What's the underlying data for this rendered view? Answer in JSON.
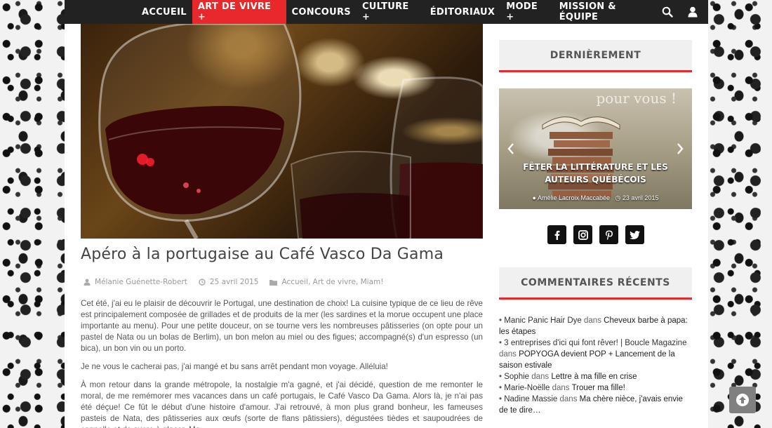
{
  "nav": {
    "items": [
      {
        "label": "ACCUEIL",
        "active": false
      },
      {
        "label": "ART DE VIVRE +",
        "active": true
      },
      {
        "label": "CONCOURS",
        "active": false
      },
      {
        "label": "CULTURE +",
        "active": false
      },
      {
        "label": "ÉDITORIAUX",
        "active": false
      },
      {
        "label": "MODE +",
        "active": false
      },
      {
        "label": "MISSION & ÉQUIPE",
        "active": false
      }
    ],
    "icons": [
      "search-icon",
      "user-icon"
    ],
    "accent_color": "#e8282b",
    "bar_color": "#222222"
  },
  "post": {
    "title": "Apéro à la portugaise au Café Vasco Da Gama",
    "author": "Mélanie Guénette-Robert",
    "date": "25 avril 2015",
    "categories": "Accueil, Art de vivre, Miam!",
    "paragraphs": [
      "Cet été, j'ai eu le plaisir de découvrir le Portugal, une destination de choix! La cuisine typique de ce lieu de rêve est principalement composée de grillades et de produits de la mer (les sardines et la morue occupent une place importante au menu). Pour une petite douceur, on se tourne vers les nombreuses pâtisseries (on opte pour un pastel de Nata ou un bolas de Berlim), un bon melon au miel ou des figues; accompagné(s) d'un espresso (un bica), un bon vin ou un porto.",
      "Je ne vous le cacherai pas, j'ai mangé et bu sans arrêt pendant mon voyage. Alléluia!",
      "À mon retour dans la grande métropole, la nostalgie m'a gagné, et j'ai décidé, question de me remonter le moral, de me remémorer mes vacances dans un café portugais, le Café Vasco Da Gama. Alors là, je n'ai pas été déçue! Ce fût le début d'une histoire d'amour. J'ai retrouvé, à mon plus grand bonheur, les fameuses pasteis de Nata, des pâtisseries aux œufs (sorte de flans pâtissiers), dégustées tièdes et saupoudrées de cannelle et de sucre à glacer. Ma"
    ]
  },
  "sidebar": {
    "recent_title": "DERNIÈREMENT",
    "slider": {
      "overlay_text": "pour vous !",
      "caption": "FÊTER LA LITTÉRATURE ET LES AUTEURS QUÉBÉCOIS",
      "author": "Amélie Lacroix Maccabée",
      "date": "23 avril 2015"
    },
    "social": [
      "facebook-icon",
      "instagram-icon",
      "pinterest-icon",
      "twitter-icon"
    ],
    "comments_title": "COMMENTAIRES RÉCENTS",
    "comments": [
      {
        "author": "Manic Panic Hair Dye",
        "dans": "dans",
        "post": "Cheveux barbe à papa: les étapes"
      },
      {
        "author": "3 entreprises d'ici qui font rêver! | Boucle Magazine",
        "dans": "dans",
        "post": "POPYOGA devient POP + Lancement de la saison estivale"
      },
      {
        "author": "Sophie",
        "dans": "dans",
        "post": "Lettre à ma fille en crise"
      },
      {
        "author": "Marie-Noëlle",
        "dans": "dans",
        "post": "Trouer ma fille!"
      },
      {
        "author": "Nadine Massie",
        "dans": "dans",
        "post": "Ma chère nièce, j'avais envie de te dire…"
      }
    ]
  }
}
